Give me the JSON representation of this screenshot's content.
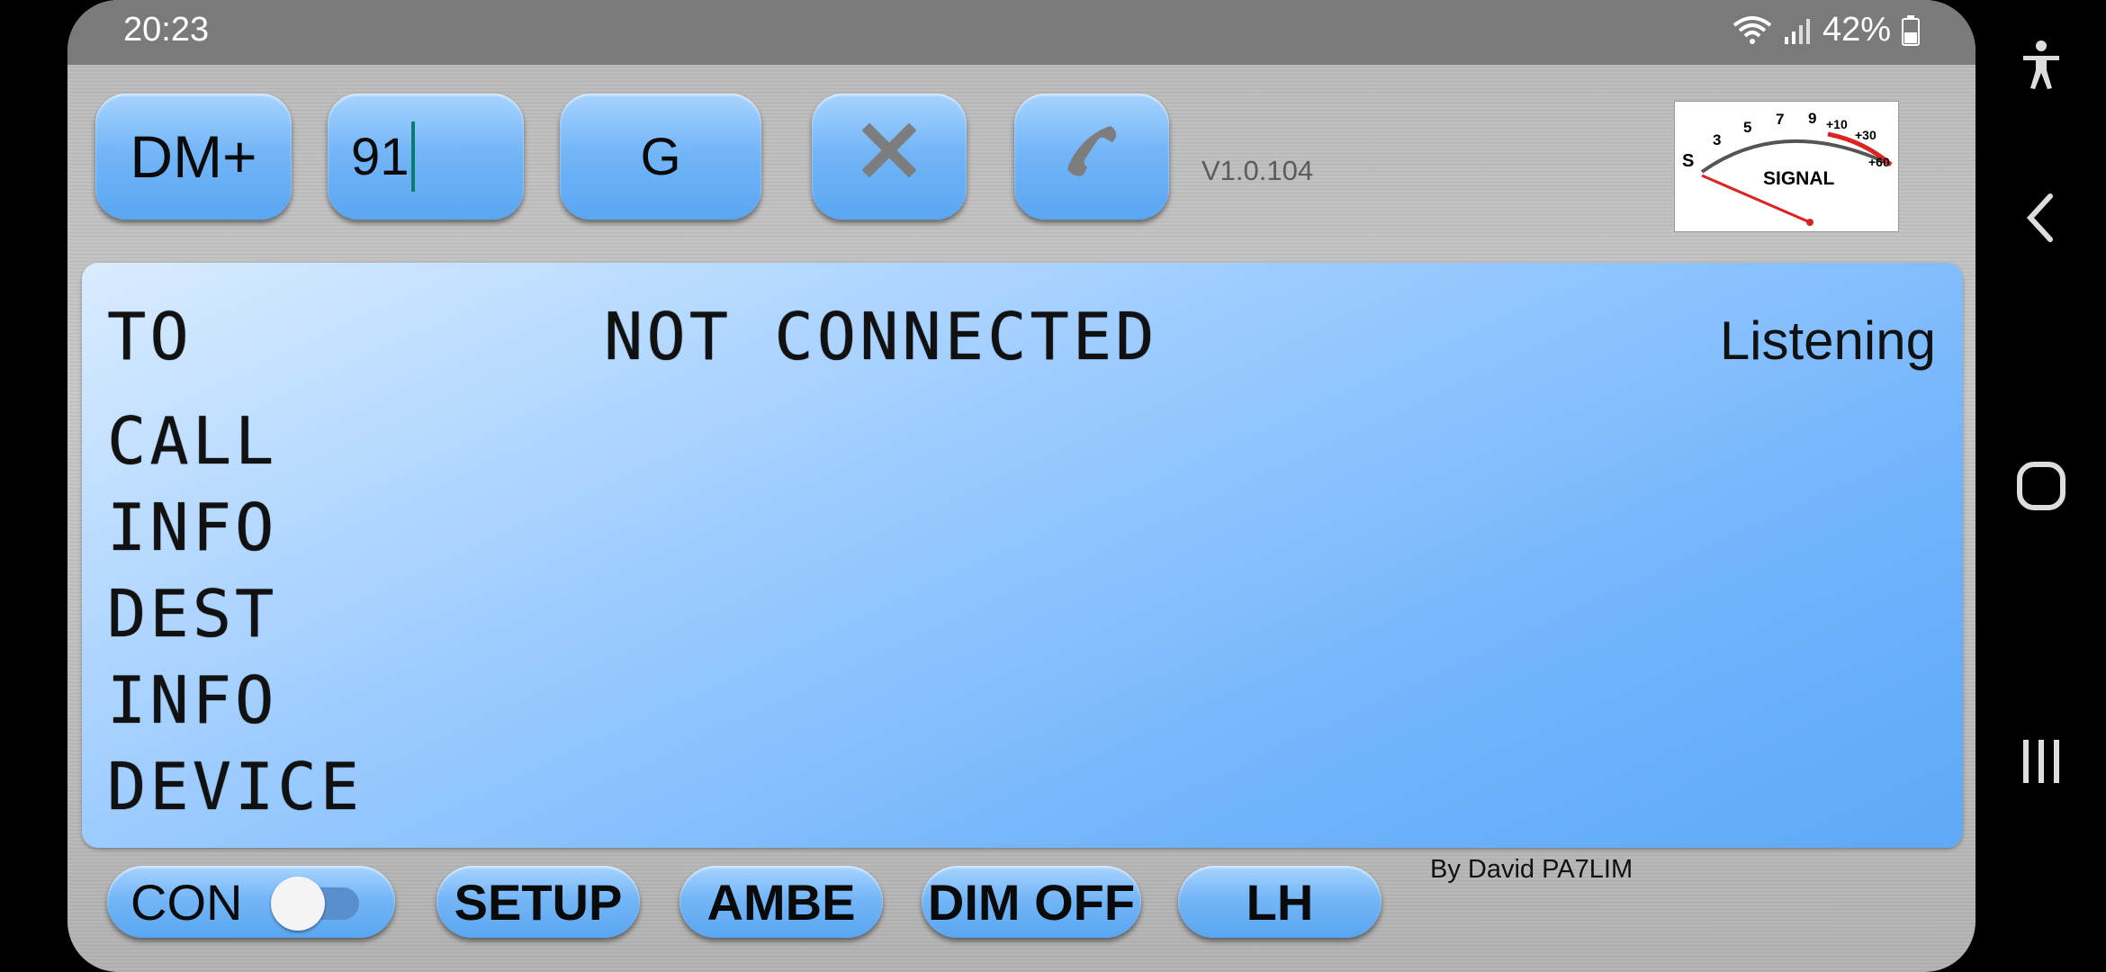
{
  "status": {
    "time": "20:23",
    "battery": "42%"
  },
  "toolbar": {
    "mode_label": "DM+",
    "talkgroup_value": "91",
    "g_label": "G",
    "close_icon": "close-icon",
    "call_icon": "phone-icon",
    "version": "V1.0.104"
  },
  "meter": {
    "scale": [
      "S",
      "3",
      "5",
      "7",
      "9",
      "+10",
      "+30",
      "+60"
    ],
    "label": "SIGNAL"
  },
  "display": {
    "to_label": "TO",
    "connection_status": "NOT CONNECTED",
    "listening": "Listening",
    "call_label": "CALL",
    "info_label": "INFO",
    "dest_label": "DEST",
    "info2_label": "INFO",
    "device_label": "DEVICE"
  },
  "bottombar": {
    "con_label": "CON",
    "con_enabled": false,
    "setup_label": "SETUP",
    "ambe_label": "AMBE",
    "dim_label": "DIM OFF",
    "lh_label": "LH",
    "credit": "By David PA7LIM"
  },
  "navbar": {
    "icons": [
      "accessibility-icon",
      "back-icon",
      "home-icon",
      "recent-apps-icon"
    ]
  }
}
